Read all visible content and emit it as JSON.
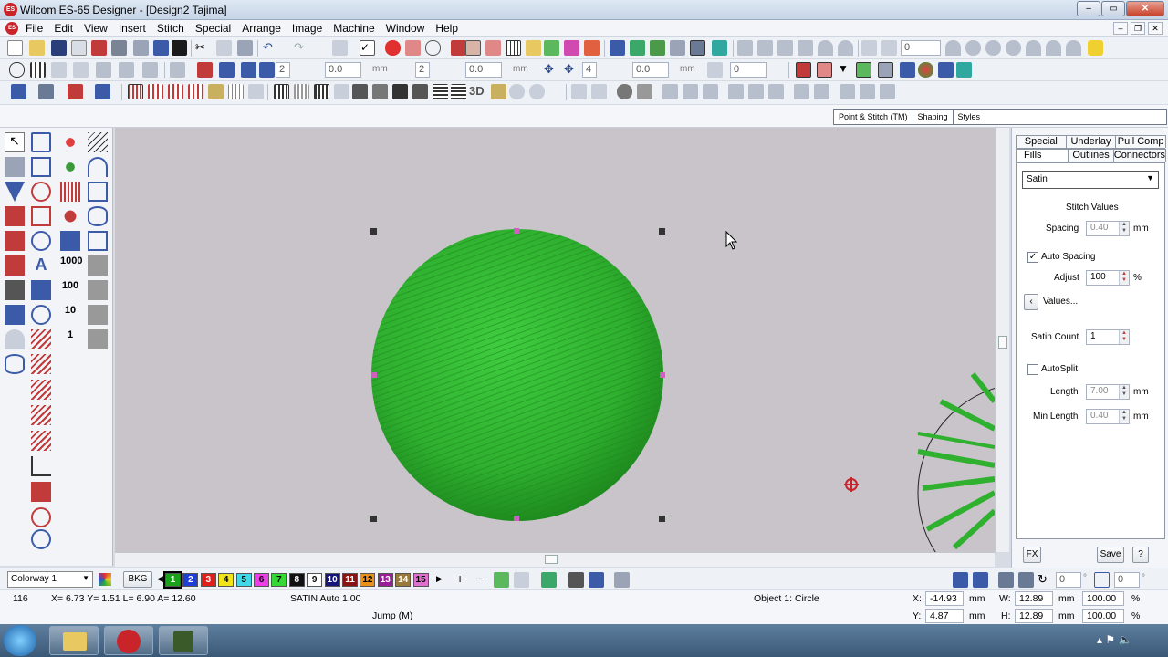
{
  "window": {
    "title": "Wilcom ES-65 Designer - [Design2     Tajima]",
    "app_icon": "ES"
  },
  "menu": {
    "items": [
      "File",
      "Edit",
      "View",
      "Insert",
      "Stitch",
      "Special",
      "Arrange",
      "Image",
      "Machine",
      "Window",
      "Help"
    ]
  },
  "toolbar1": {
    "angle_value": "0"
  },
  "toolbar2": {
    "spin_a": "2",
    "spin_a_val": "0.0",
    "spin_a_unit": "mm",
    "spin_b": "2",
    "spin_b_val": "0.0",
    "spin_b_unit": "mm",
    "spin_c": "4",
    "spin_c_val": "0.0",
    "spin_c_unit": "mm",
    "angle_val": "0"
  },
  "toolbar3": {
    "label_3d": "3D"
  },
  "tabs": [
    "Point & Stitch (TM)",
    "Shaping",
    "Styles"
  ],
  "panel": {
    "tabs_row1": [
      "Special",
      "Underlay",
      "Pull Comp"
    ],
    "tabs_row2": [
      "Fills",
      "Outlines",
      "Connectors"
    ],
    "fill_type": "Satin",
    "stitch_values_label": "Stitch Values",
    "spacing_label": "Spacing",
    "spacing_value": "0.40",
    "spacing_unit": "mm",
    "auto_spacing_label": "Auto Spacing",
    "auto_spacing_checked": true,
    "adjust_label": "Adjust",
    "adjust_value": "100",
    "adjust_unit": "%",
    "values_button": "Values...",
    "satin_count_label": "Satin Count",
    "satin_count_value": "1",
    "autosplit_label": "AutoSplit",
    "length_label": "Length",
    "length_value": "7.00",
    "length_unit": "mm",
    "min_length_label": "Min Length",
    "min_length_value": "0.40",
    "min_length_unit": "mm",
    "fx_button": "FX",
    "save_button": "Save",
    "help_button": "?"
  },
  "colorbar": {
    "colorway": "Colorway 1",
    "bkg_label": "BKG",
    "swatches": [
      {
        "n": "1",
        "color": "#1aa31a",
        "fg": "#ffffff"
      },
      {
        "n": "2",
        "color": "#1e3fd6",
        "fg": "#ffffff"
      },
      {
        "n": "3",
        "color": "#e0201a",
        "fg": "#ffffff"
      },
      {
        "n": "4",
        "color": "#f0e41a",
        "fg": "#000000"
      },
      {
        "n": "5",
        "color": "#42d8e8",
        "fg": "#000000"
      },
      {
        "n": "6",
        "color": "#ee3ee8",
        "fg": "#000000"
      },
      {
        "n": "7",
        "color": "#35d835",
        "fg": "#000000"
      },
      {
        "n": "8",
        "color": "#111111",
        "fg": "#ffffff"
      },
      {
        "n": "9",
        "color": "#ffffff",
        "fg": "#000000"
      },
      {
        "n": "10",
        "color": "#15157a",
        "fg": "#ffffff"
      },
      {
        "n": "11",
        "color": "#8a1414",
        "fg": "#ffffff"
      },
      {
        "n": "12",
        "color": "#e8901a",
        "fg": "#000000"
      },
      {
        "n": "13",
        "color": "#9a1e9a",
        "fg": "#ffffff"
      },
      {
        "n": "14",
        "color": "#9a7a3a",
        "fg": "#ffffff"
      },
      {
        "n": "15",
        "color": "#e070d0",
        "fg": "#000000"
      }
    ],
    "rotate_value": "0",
    "rotate_unit": "°",
    "slant_value": "0",
    "slant_unit": "°"
  },
  "status": {
    "stitch_count": "116",
    "coords": "X=  6.73 Y=   1.51 L=   6.90 A=  12.60",
    "stitch_type": "SATIN Auto  1.00",
    "object_info": "Object 1: Circle",
    "jump": "Jump (M)",
    "x_label": "X:",
    "x_value": "-14.93",
    "x_unit": "mm",
    "y_label": "Y:",
    "y_value": "4.87",
    "y_unit": "mm",
    "w_label": "W:",
    "w_value": "12.89",
    "w_unit": "mm",
    "w_pct": "100.00",
    "w_pct_unit": "%",
    "h_label": "H:",
    "h_value": "12.89",
    "h_unit": "mm",
    "h_pct": "100.00",
    "h_pct_unit": "%"
  },
  "colors": {
    "fill_green": "#2fb82f",
    "canvas_bg": "#c8c4c9",
    "accent_red": "#c8242a"
  }
}
